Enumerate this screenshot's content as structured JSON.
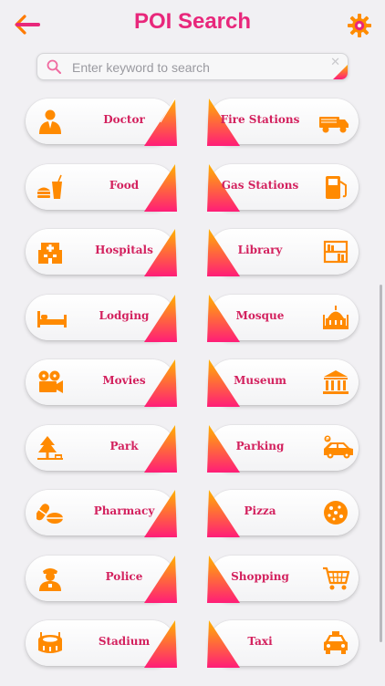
{
  "header": {
    "title": "POI Search",
    "back_icon": "back-arrow-icon",
    "settings_icon": "gear-icon"
  },
  "search": {
    "placeholder": "Enter keyword to search",
    "clear_label": "✕"
  },
  "colors": {
    "accent": "#e8277b",
    "label": "#d3215e",
    "icon": "#ff8a00",
    "gradient_top": "#ffb200",
    "gradient_bottom": "#ff1d78"
  },
  "categories": [
    {
      "label": "Doctor",
      "icon": "doctor-icon"
    },
    {
      "label": "Fire Stations",
      "icon": "fire-truck-icon"
    },
    {
      "label": "Food",
      "icon": "food-icon"
    },
    {
      "label": "Gas Stations",
      "icon": "gas-pump-icon"
    },
    {
      "label": "Hospitals",
      "icon": "hospital-icon"
    },
    {
      "label": "Library",
      "icon": "library-icon"
    },
    {
      "label": "Lodging",
      "icon": "bed-icon"
    },
    {
      "label": "Mosque",
      "icon": "mosque-icon"
    },
    {
      "label": "Movies",
      "icon": "film-camera-icon"
    },
    {
      "label": "Museum",
      "icon": "museum-icon"
    },
    {
      "label": "Park",
      "icon": "tree-icon"
    },
    {
      "label": "Parking",
      "icon": "car-parking-icon"
    },
    {
      "label": "Pharmacy",
      "icon": "pills-icon"
    },
    {
      "label": "Pizza",
      "icon": "pizza-icon"
    },
    {
      "label": "Police",
      "icon": "police-icon"
    },
    {
      "label": "Shopping",
      "icon": "shopping-cart-icon"
    },
    {
      "label": "Stadium",
      "icon": "stadium-icon"
    },
    {
      "label": "Taxi",
      "icon": "taxi-icon"
    }
  ]
}
